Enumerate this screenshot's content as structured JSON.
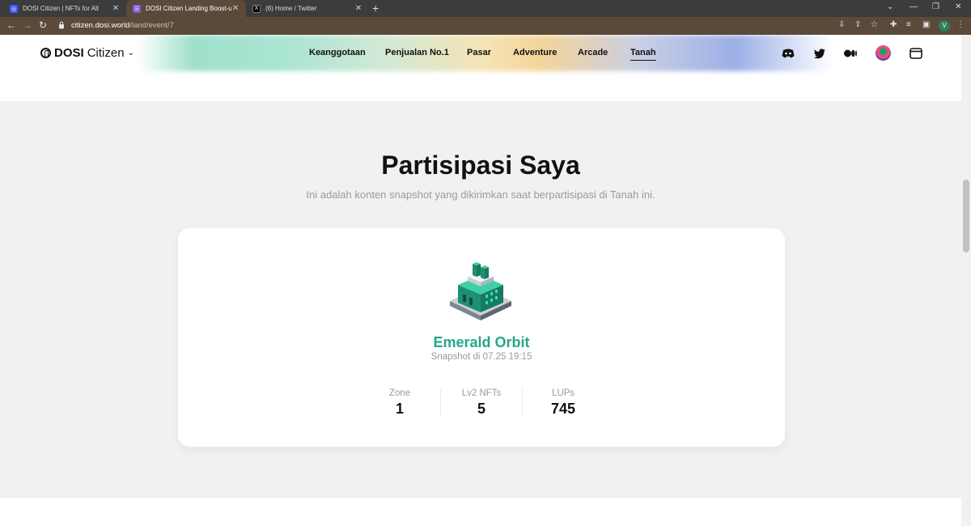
{
  "browser": {
    "tabs": [
      {
        "title": "DOSI Citizen | NFTs for All",
        "active": false
      },
      {
        "title": "DOSI Citizen Landing Boost-up E",
        "active": true
      },
      {
        "title": "(6) Home / Twitter",
        "active": false
      }
    ],
    "url_host": "citizen.dosi.world",
    "url_path": "/land/event/7",
    "profile_initial": "V"
  },
  "header": {
    "logo_bold": "DOSI",
    "logo_light": "Citizen",
    "nav": [
      "Keanggotaan",
      "Penjualan No.1",
      "Pasar",
      "Adventure",
      "Arcade",
      "Tanah"
    ],
    "active_nav": "Tanah",
    "icons": [
      "discord-icon",
      "twitter-icon",
      "medium-icon",
      "avatar",
      "wallet-icon"
    ]
  },
  "main": {
    "title": "Partisipasi Saya",
    "subtitle": "Ini adalah konten snapshot yang dikirimkan saat berpartisipasi di Tanah ini.",
    "card": {
      "land_name": "Emerald Orbit",
      "snapshot": "Snapshot di 07.25 19:15",
      "stats": [
        {
          "label": "Zone",
          "value": "1"
        },
        {
          "label": "Lv2 NFTs",
          "value": "5"
        },
        {
          "label": "LUPs",
          "value": "745"
        }
      ]
    }
  },
  "colors": {
    "accent": "#26a68a",
    "chrome_tab_bar": "#3c3c3c",
    "chrome_toolbar": "#5b4a3a",
    "section_bg": "#f1f1f1"
  }
}
